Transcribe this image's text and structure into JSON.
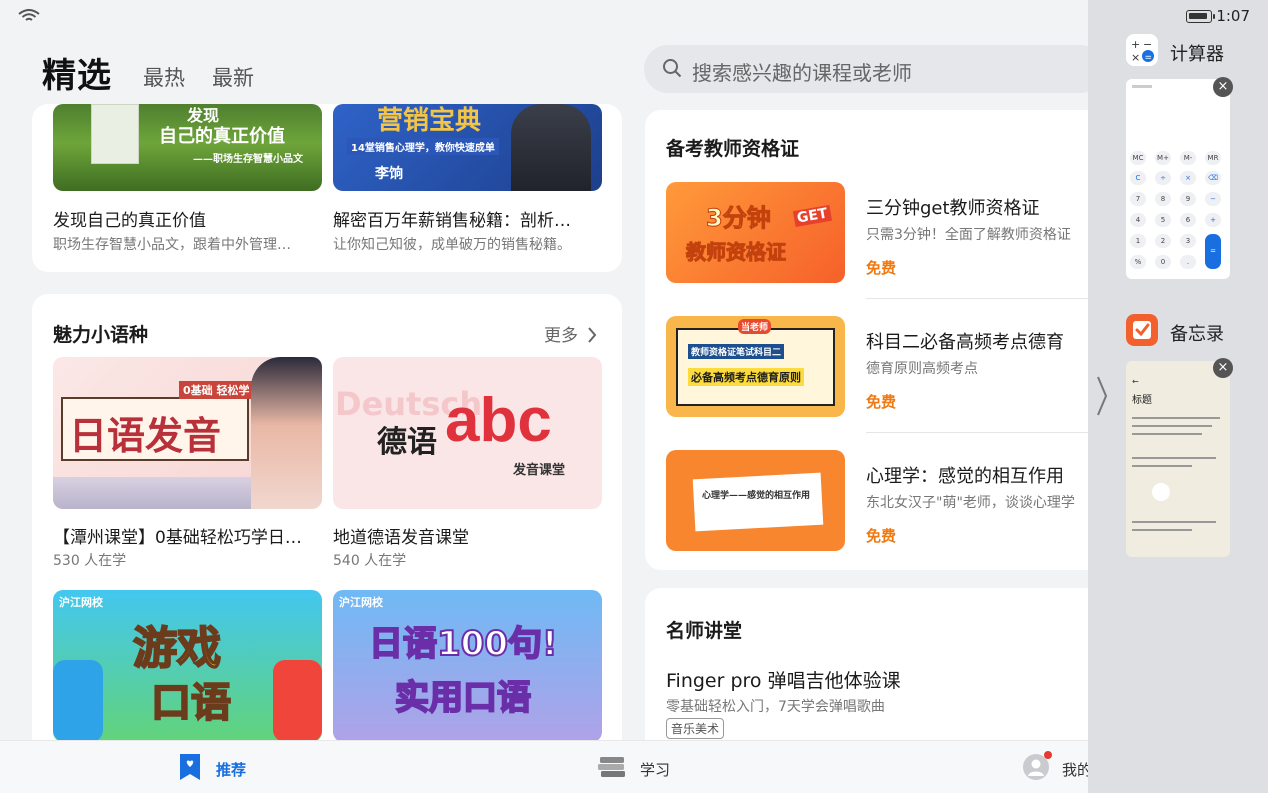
{
  "status": {
    "time": "1:07"
  },
  "header": {
    "tabs": [
      {
        "label": "精选"
      },
      {
        "label": "最热"
      },
      {
        "label": "最新"
      }
    ],
    "search_placeholder": "搜索感兴趣的课程或老师"
  },
  "top_courses": [
    {
      "title": "发现自己的真正价值",
      "subtitle": "职场生存智慧小品文，跟着中外管理…",
      "art": [
        "发现",
        "自己的真正价值",
        "——职场生存智慧小品文"
      ]
    },
    {
      "title": "解密百万年薪销售秘籍：剖析…",
      "subtitle": "让你知己知彼，成单破万的销售秘籍。",
      "art": [
        "营销宝典",
        "14堂销售心理学，教你快速成单",
        "李饷"
      ]
    }
  ],
  "language_section": {
    "title": "魅力小语种",
    "more": "更多",
    "courses": [
      {
        "title": "【潭州课堂】0基础轻松巧学日…",
        "subtitle": "530 人在学",
        "art": [
          "日语发音",
          "0基础 轻松学"
        ]
      },
      {
        "title": "地道德语发音课堂",
        "subtitle": "540 人在学",
        "art": [
          "德语",
          "abc",
          "发音课堂",
          "Deutsch"
        ]
      },
      {
        "art": [
          "游戏",
          "口语",
          "沪江网校"
        ]
      },
      {
        "art": [
          "日语100句!",
          "实用口语",
          "沪江网校"
        ]
      }
    ]
  },
  "teacher_section": {
    "title": "备考教师资格证",
    "courses": [
      {
        "title": "三分钟get教师资格证",
        "subtitle": "只需3分钟！全面了解教师资格证",
        "price": "免费",
        "art": [
          "3分钟",
          "GET",
          "教师资格证"
        ]
      },
      {
        "title": "科目二必备高频考点德育",
        "subtitle": "德育原则高频考点",
        "price": "免费",
        "art": [
          "当老师",
          "教师资格证笔试科目二",
          "必备高频考点德育原则"
        ]
      },
      {
        "title": "心理学：感觉的相互作用",
        "subtitle": "东北女汉子\"萌\"老师，谈谈心理学",
        "price": "免费",
        "art": [
          "心理学——感觉的相互作用"
        ]
      }
    ]
  },
  "famous_section": {
    "title": "名师讲堂",
    "courses": [
      {
        "title": "Finger pro 弹唱吉他体验课",
        "subtitle": "零基础轻松入门，7天学会弹唱歌曲",
        "tag": "音乐美术"
      }
    ]
  },
  "bottom_nav": [
    {
      "label": "推荐",
      "active": true
    },
    {
      "label": "学习",
      "active": false
    },
    {
      "label": "我的",
      "active": false
    }
  ],
  "dock": {
    "apps": [
      {
        "name": "计算器",
        "preview_keys": [
          "MC",
          "M+",
          "M-",
          "MR",
          "C",
          "÷",
          "×",
          "⌫",
          "7",
          "8",
          "9",
          "−",
          "4",
          "5",
          "6",
          "+",
          "1",
          "2",
          "3",
          "=",
          "%",
          "0",
          "."
        ]
      },
      {
        "name": "备忘录",
        "preview_title": "标题"
      }
    ]
  },
  "colors": {
    "accent_blue": "#1a6fe0",
    "free_orange": "#f07a12"
  }
}
